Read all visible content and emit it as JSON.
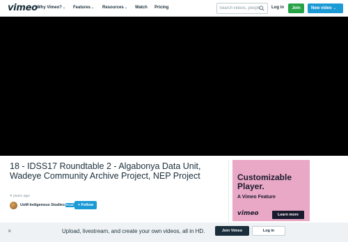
{
  "header": {
    "logo": "vimeo",
    "nav": [
      {
        "label": "Why Vimeo?",
        "has_dropdown": true
      },
      {
        "label": "Features",
        "has_dropdown": true
      },
      {
        "label": "Resources",
        "has_dropdown": true
      },
      {
        "label": "Watch",
        "has_dropdown": false
      },
      {
        "label": "Pricing",
        "has_dropdown": false
      }
    ],
    "search_placeholder": "Search videos, people...",
    "search_icon": "search-icon",
    "login_label": "Log in",
    "join_label": "Join",
    "new_video_label": "New video",
    "new_video_chevron": "⌄"
  },
  "video": {
    "title": "18 - IDSS17 Roundtable 2 - Algabonya Data Unit, Wadeye Community Archive Project, NEP Project",
    "posted": "4 years ago",
    "channel": "UoM Indigenous Studies",
    "channel_badge": "PLUS",
    "follow_label": "+ Follow"
  },
  "ad": {
    "title": "Customizable Player.",
    "subtitle": "A Vimeo Feature",
    "logo": "vimeo",
    "button_label": "Learn more",
    "background": "#e9a8c5"
  },
  "banner": {
    "close_icon": "close-icon",
    "close_glyph": "×",
    "text": "Upload, livestream, and create your own videos, all in HD.",
    "join_label": "Join Vimeo",
    "login_label": "Log in"
  },
  "colors": {
    "join_green": "#26a347",
    "accent_blue": "#1c9ad6",
    "dark_navy": "#1a2e3b"
  }
}
